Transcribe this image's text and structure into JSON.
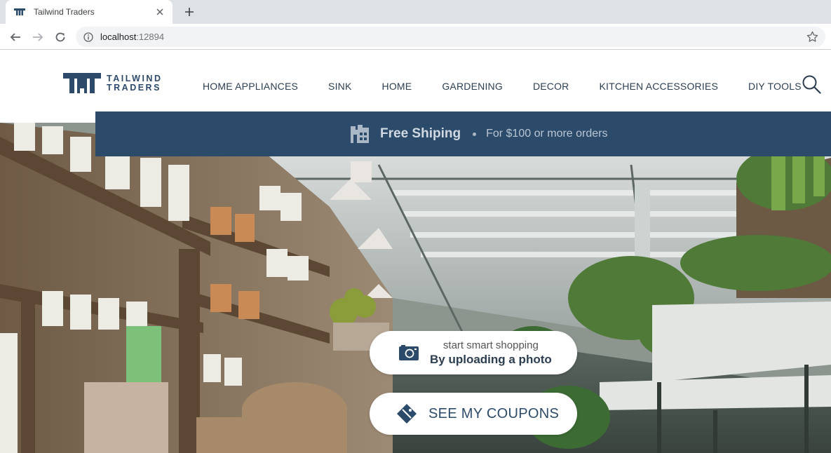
{
  "browser": {
    "tab_title": "Tailwind Traders",
    "url_host": "localhost",
    "url_port": ":12894"
  },
  "header": {
    "logo_line1": "TAILWIND",
    "logo_line2": "TRADERS",
    "nav": [
      "HOME APPLIANCES",
      "SINK",
      "HOME",
      "GARDENING",
      "DECOR",
      "KITCHEN ACCESSORIES",
      "DIY TOOLS"
    ]
  },
  "banner": {
    "title": "Free Shiping",
    "subtitle": "For $100 or more orders"
  },
  "hero": {
    "upload_small": "start smart shopping",
    "upload_big": "By uploading a photo",
    "coupons_label": "SEE MY COUPONS"
  },
  "colors": {
    "brand_navy": "#2c4b6b",
    "nav_text": "#2c3e50"
  },
  "icons": [
    "tailwind-logo-icon",
    "close-icon",
    "plus-icon",
    "back-arrow-icon",
    "forward-arrow-icon",
    "reload-icon",
    "info-icon",
    "star-icon",
    "search-icon",
    "warehouse-icon",
    "camera-icon",
    "coupon-tag-icon"
  ]
}
